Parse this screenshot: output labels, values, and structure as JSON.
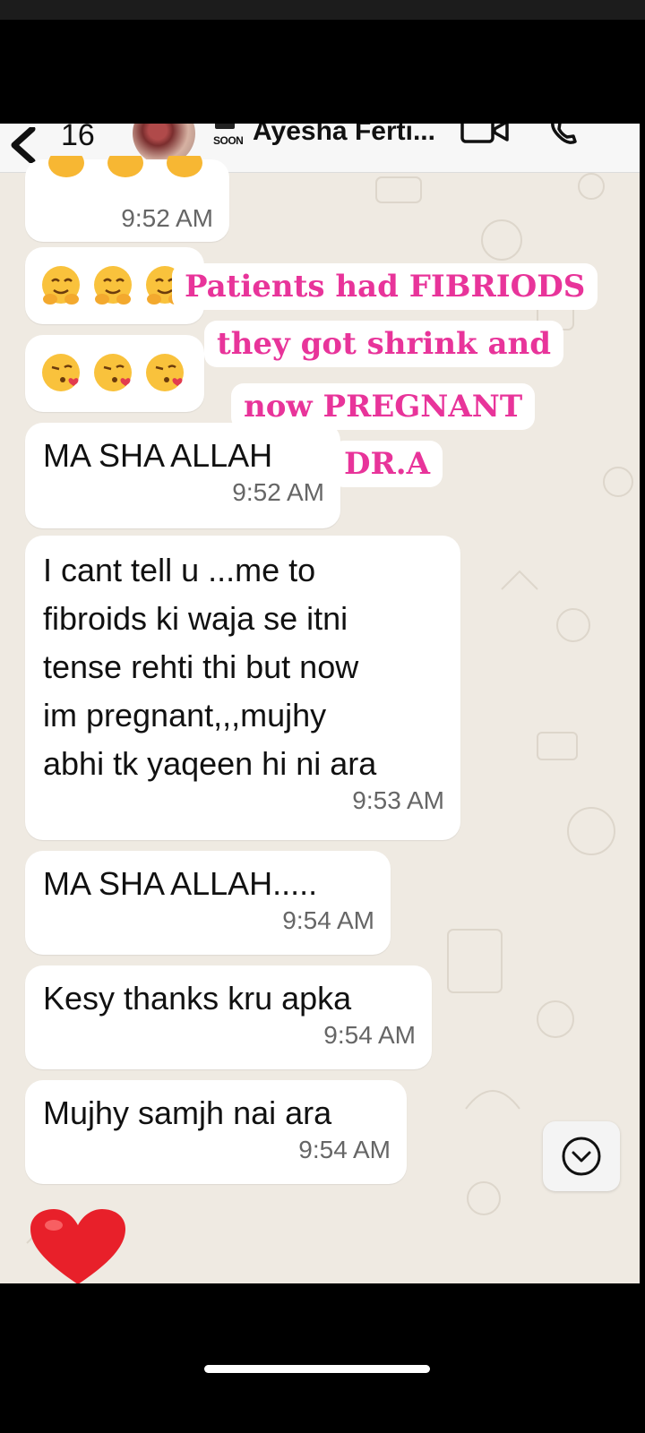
{
  "header": {
    "back_count": "16",
    "soon_label": "SOON",
    "contact_name": "Ayesha Ferti..."
  },
  "messages": [
    {
      "time": "9:52 AM"
    },
    {
      "text": "MA SHA ALLAH",
      "time": "9:52 AM"
    },
    {
      "text": "I cant tell u ...me to\nfibroids ki waja se itni\ntense rehti thi but now\nim pregnant,,,mujhy\nabhi tk yaqeen hi ni ara",
      "time": "9:53 AM"
    },
    {
      "text": "MA SHA ALLAH.....",
      "time": "9:54 AM"
    },
    {
      "text": "Kesy thanks kru apka",
      "time": "9:54 AM"
    },
    {
      "text": "Mujhy samjh nai ara",
      "time": "9:54 AM"
    }
  ],
  "overlay": {
    "line1": "Patients had FIBRIODS",
    "line2": "they got shrink and",
    "line3": "now PREGNANT",
    "line4": "DR.A"
  },
  "colors": {
    "chat_bg": "#efeae2",
    "bubble": "#ffffff",
    "overlay_text": "#e8349a"
  },
  "icons": [
    "back-chevron-icon",
    "video-call-icon",
    "phone-call-icon",
    "scroll-down-icon",
    "heart-emoji",
    "hugging-emoji",
    "kiss-emoji"
  ]
}
